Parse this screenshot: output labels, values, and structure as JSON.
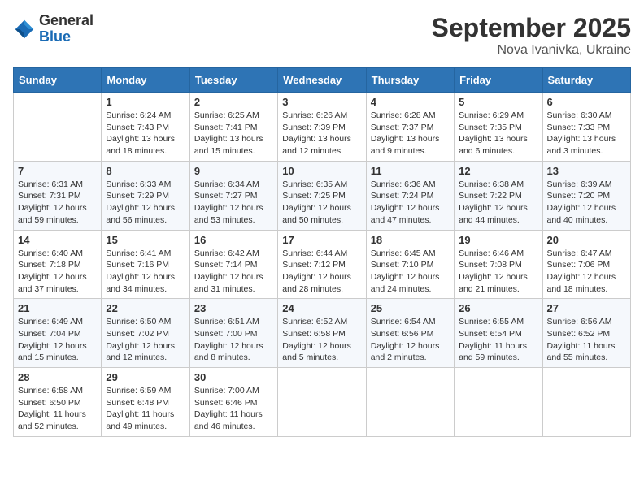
{
  "logo": {
    "general": "General",
    "blue": "Blue"
  },
  "header": {
    "month": "September 2025",
    "location": "Nova Ivanivka, Ukraine"
  },
  "weekdays": [
    "Sunday",
    "Monday",
    "Tuesday",
    "Wednesday",
    "Thursday",
    "Friday",
    "Saturday"
  ],
  "weeks": [
    [
      {
        "day": "",
        "info": ""
      },
      {
        "day": "1",
        "info": "Sunrise: 6:24 AM\nSunset: 7:43 PM\nDaylight: 13 hours\nand 18 minutes."
      },
      {
        "day": "2",
        "info": "Sunrise: 6:25 AM\nSunset: 7:41 PM\nDaylight: 13 hours\nand 15 minutes."
      },
      {
        "day": "3",
        "info": "Sunrise: 6:26 AM\nSunset: 7:39 PM\nDaylight: 13 hours\nand 12 minutes."
      },
      {
        "day": "4",
        "info": "Sunrise: 6:28 AM\nSunset: 7:37 PM\nDaylight: 13 hours\nand 9 minutes."
      },
      {
        "day": "5",
        "info": "Sunrise: 6:29 AM\nSunset: 7:35 PM\nDaylight: 13 hours\nand 6 minutes."
      },
      {
        "day": "6",
        "info": "Sunrise: 6:30 AM\nSunset: 7:33 PM\nDaylight: 13 hours\nand 3 minutes."
      }
    ],
    [
      {
        "day": "7",
        "info": "Sunrise: 6:31 AM\nSunset: 7:31 PM\nDaylight: 12 hours\nand 59 minutes."
      },
      {
        "day": "8",
        "info": "Sunrise: 6:33 AM\nSunset: 7:29 PM\nDaylight: 12 hours\nand 56 minutes."
      },
      {
        "day": "9",
        "info": "Sunrise: 6:34 AM\nSunset: 7:27 PM\nDaylight: 12 hours\nand 53 minutes."
      },
      {
        "day": "10",
        "info": "Sunrise: 6:35 AM\nSunset: 7:25 PM\nDaylight: 12 hours\nand 50 minutes."
      },
      {
        "day": "11",
        "info": "Sunrise: 6:36 AM\nSunset: 7:24 PM\nDaylight: 12 hours\nand 47 minutes."
      },
      {
        "day": "12",
        "info": "Sunrise: 6:38 AM\nSunset: 7:22 PM\nDaylight: 12 hours\nand 44 minutes."
      },
      {
        "day": "13",
        "info": "Sunrise: 6:39 AM\nSunset: 7:20 PM\nDaylight: 12 hours\nand 40 minutes."
      }
    ],
    [
      {
        "day": "14",
        "info": "Sunrise: 6:40 AM\nSunset: 7:18 PM\nDaylight: 12 hours\nand 37 minutes."
      },
      {
        "day": "15",
        "info": "Sunrise: 6:41 AM\nSunset: 7:16 PM\nDaylight: 12 hours\nand 34 minutes."
      },
      {
        "day": "16",
        "info": "Sunrise: 6:42 AM\nSunset: 7:14 PM\nDaylight: 12 hours\nand 31 minutes."
      },
      {
        "day": "17",
        "info": "Sunrise: 6:44 AM\nSunset: 7:12 PM\nDaylight: 12 hours\nand 28 minutes."
      },
      {
        "day": "18",
        "info": "Sunrise: 6:45 AM\nSunset: 7:10 PM\nDaylight: 12 hours\nand 24 minutes."
      },
      {
        "day": "19",
        "info": "Sunrise: 6:46 AM\nSunset: 7:08 PM\nDaylight: 12 hours\nand 21 minutes."
      },
      {
        "day": "20",
        "info": "Sunrise: 6:47 AM\nSunset: 7:06 PM\nDaylight: 12 hours\nand 18 minutes."
      }
    ],
    [
      {
        "day": "21",
        "info": "Sunrise: 6:49 AM\nSunset: 7:04 PM\nDaylight: 12 hours\nand 15 minutes."
      },
      {
        "day": "22",
        "info": "Sunrise: 6:50 AM\nSunset: 7:02 PM\nDaylight: 12 hours\nand 12 minutes."
      },
      {
        "day": "23",
        "info": "Sunrise: 6:51 AM\nSunset: 7:00 PM\nDaylight: 12 hours\nand 8 minutes."
      },
      {
        "day": "24",
        "info": "Sunrise: 6:52 AM\nSunset: 6:58 PM\nDaylight: 12 hours\nand 5 minutes."
      },
      {
        "day": "25",
        "info": "Sunrise: 6:54 AM\nSunset: 6:56 PM\nDaylight: 12 hours\nand 2 minutes."
      },
      {
        "day": "26",
        "info": "Sunrise: 6:55 AM\nSunset: 6:54 PM\nDaylight: 11 hours\nand 59 minutes."
      },
      {
        "day": "27",
        "info": "Sunrise: 6:56 AM\nSunset: 6:52 PM\nDaylight: 11 hours\nand 55 minutes."
      }
    ],
    [
      {
        "day": "28",
        "info": "Sunrise: 6:58 AM\nSunset: 6:50 PM\nDaylight: 11 hours\nand 52 minutes."
      },
      {
        "day": "29",
        "info": "Sunrise: 6:59 AM\nSunset: 6:48 PM\nDaylight: 11 hours\nand 49 minutes."
      },
      {
        "day": "30",
        "info": "Sunrise: 7:00 AM\nSunset: 6:46 PM\nDaylight: 11 hours\nand 46 minutes."
      },
      {
        "day": "",
        "info": ""
      },
      {
        "day": "",
        "info": ""
      },
      {
        "day": "",
        "info": ""
      },
      {
        "day": "",
        "info": ""
      }
    ]
  ]
}
